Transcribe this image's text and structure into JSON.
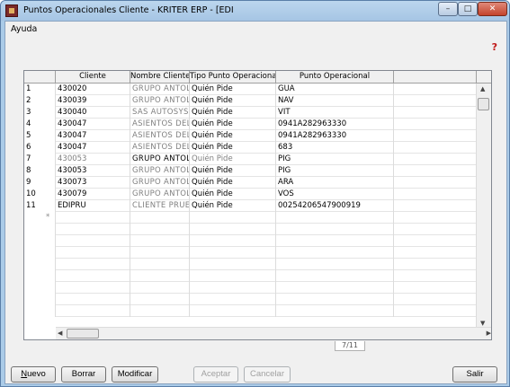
{
  "window": {
    "title": "Puntos Operacionales Cliente - KRITER ERP - [EDI",
    "minimize": "–",
    "maximize": "□",
    "close": "✕"
  },
  "menu": {
    "help": "Ayuda"
  },
  "icons": {
    "app": "app-icon",
    "help": "help-icon"
  },
  "grid": {
    "columns": [
      "Cliente",
      "Nombre Cliente",
      "Tipo Punto Operacional",
      "Punto Operacional"
    ],
    "rows": [
      {
        "n": "1",
        "cliente": "430020",
        "nombre": "GRUPO ANTOL",
        "tipo": "Quién Pide",
        "punto": "GUA"
      },
      {
        "n": "2",
        "cliente": "430039",
        "nombre": "GRUPO ANTOL",
        "tipo": "Quién Pide",
        "punto": "NAV"
      },
      {
        "n": "3",
        "cliente": "430040",
        "nombre": "SAS AUTOSYS",
        "tipo": "Quién Pide",
        "punto": "VIT"
      },
      {
        "n": "4",
        "cliente": "430047",
        "nombre": "ASIENTOS DEL",
        "tipo": "Quién Pide",
        "punto": "0941A282963330"
      },
      {
        "n": "5",
        "cliente": "430047",
        "nombre": "ASIENTOS DEL",
        "tipo": "Quién Pide",
        "punto": "0941A282963330"
      },
      {
        "n": "6",
        "cliente": "430047",
        "nombre": "ASIENTOS DEL",
        "tipo": "Quién Pide",
        "punto": "683"
      },
      {
        "n": "7",
        "cliente": "430053",
        "nombre": "GRUPO ANTOL",
        "tipo": "Quién Pide",
        "punto": "PIG"
      },
      {
        "n": "8",
        "cliente": "430053",
        "nombre": "GRUPO ANTOL",
        "tipo": "Quién Pide",
        "punto": "PIG"
      },
      {
        "n": "9",
        "cliente": "430073",
        "nombre": "GRUPO ANTOL",
        "tipo": "Quién Pide",
        "punto": "ARA"
      },
      {
        "n": "10",
        "cliente": "430079",
        "nombre": "GRUPO ANTOL",
        "tipo": "Quién Pide",
        "punto": "VOS"
      },
      {
        "n": "11",
        "cliente": "EDIPRU",
        "nombre": "CLIENTE PRUE",
        "tipo": "Quién Pide",
        "punto": "00254206547900919"
      }
    ],
    "new_row_marker": "*",
    "page_count": "7/11"
  },
  "buttons": {
    "nuevo": "Nuevo",
    "borrar": "Borrar",
    "modificar": "Modificar",
    "aceptar": "Aceptar",
    "cancelar": "Cancelar",
    "salir": "Salir"
  }
}
